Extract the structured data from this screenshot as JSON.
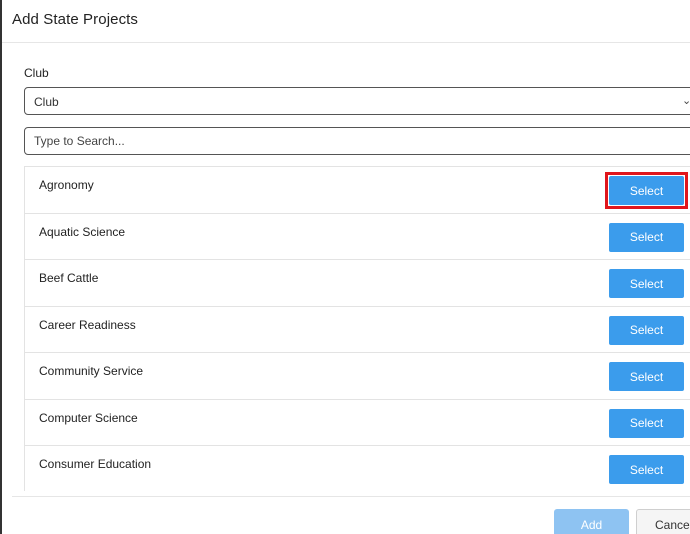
{
  "modal": {
    "title": "Add State Projects"
  },
  "club_field": {
    "label": "Club",
    "selected_value": "Club",
    "icon": "chevron-down-icon"
  },
  "search": {
    "placeholder": "Type to Search...",
    "value": ""
  },
  "projects": [
    {
      "name": "Agronomy",
      "button_label": "Select",
      "highlighted": true
    },
    {
      "name": "Aquatic Science",
      "button_label": "Select"
    },
    {
      "name": "Beef Cattle",
      "button_label": "Select"
    },
    {
      "name": "Career Readiness",
      "button_label": "Select"
    },
    {
      "name": "Community Service",
      "button_label": "Select"
    },
    {
      "name": "Computer Science",
      "button_label": "Select"
    },
    {
      "name": "Consumer Education",
      "button_label": "Select"
    }
  ],
  "footer": {
    "add_label": "Add",
    "cancel_label": "Cancel"
  },
  "colors": {
    "select_button": "#3b9cec",
    "add_button_disabled": "#8ec3f2",
    "highlight": "#e0161c"
  }
}
